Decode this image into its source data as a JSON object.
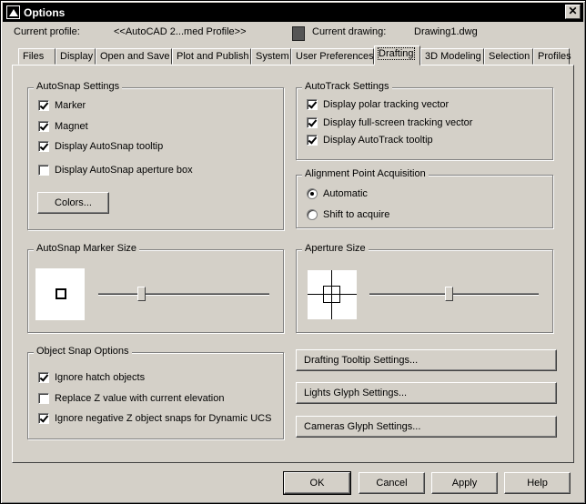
{
  "window": {
    "title": "Options",
    "close_glyph": "✕"
  },
  "profile": {
    "current_profile_label": "Current profile:",
    "current_profile_value": "<<AutoCAD 2...med Profile>>",
    "current_drawing_label": "Current drawing:",
    "current_drawing_value": "Drawing1.dwg"
  },
  "tabs": [
    {
      "label": "Files"
    },
    {
      "label": "Display"
    },
    {
      "label": "Open and Save"
    },
    {
      "label": "Plot and Publish"
    },
    {
      "label": "System"
    },
    {
      "label": "User Preferences"
    },
    {
      "label": "Drafting"
    },
    {
      "label": "3D Modeling"
    },
    {
      "label": "Selection"
    },
    {
      "label": "Profiles"
    }
  ],
  "active_tab": "Drafting",
  "autosnap_settings": {
    "legend": "AutoSnap Settings",
    "items": [
      {
        "label": "Marker",
        "checked": true
      },
      {
        "label": "Magnet",
        "checked": true
      },
      {
        "label": "Display AutoSnap tooltip",
        "checked": true
      },
      {
        "label": "Display AutoSnap aperture box",
        "checked": false
      }
    ],
    "colors_button": "Colors..."
  },
  "autotrack_settings": {
    "legend": "AutoTrack Settings",
    "items": [
      {
        "label": "Display polar tracking vector",
        "checked": true
      },
      {
        "label": "Display full-screen tracking vector",
        "checked": true
      },
      {
        "label": "Display AutoTrack tooltip",
        "checked": true
      }
    ]
  },
  "alignment_point": {
    "legend": "Alignment Point Acquisition",
    "options": [
      {
        "label": "Automatic",
        "selected": true
      },
      {
        "label": "Shift to acquire",
        "selected": false
      }
    ]
  },
  "marker_size": {
    "legend": "AutoSnap Marker Size",
    "level": 0.24
  },
  "aperture_size": {
    "legend": "Aperture Size",
    "level": 0.47
  },
  "object_snap": {
    "legend": "Object Snap Options",
    "items": [
      {
        "label": "Ignore hatch objects",
        "checked": true
      },
      {
        "label": "Replace Z value with current elevation",
        "checked": false
      },
      {
        "label": "Ignore negative Z object snaps for Dynamic UCS",
        "checked": true
      }
    ]
  },
  "side_buttons": {
    "drafting_tooltip": "Drafting Tooltip Settings...",
    "lights_glyph": "Lights Glyph Settings...",
    "cameras_glyph": "Cameras Glyph Settings..."
  },
  "dialog_buttons": {
    "ok": "OK",
    "cancel": "Cancel",
    "apply": "Apply",
    "help": "Help"
  }
}
